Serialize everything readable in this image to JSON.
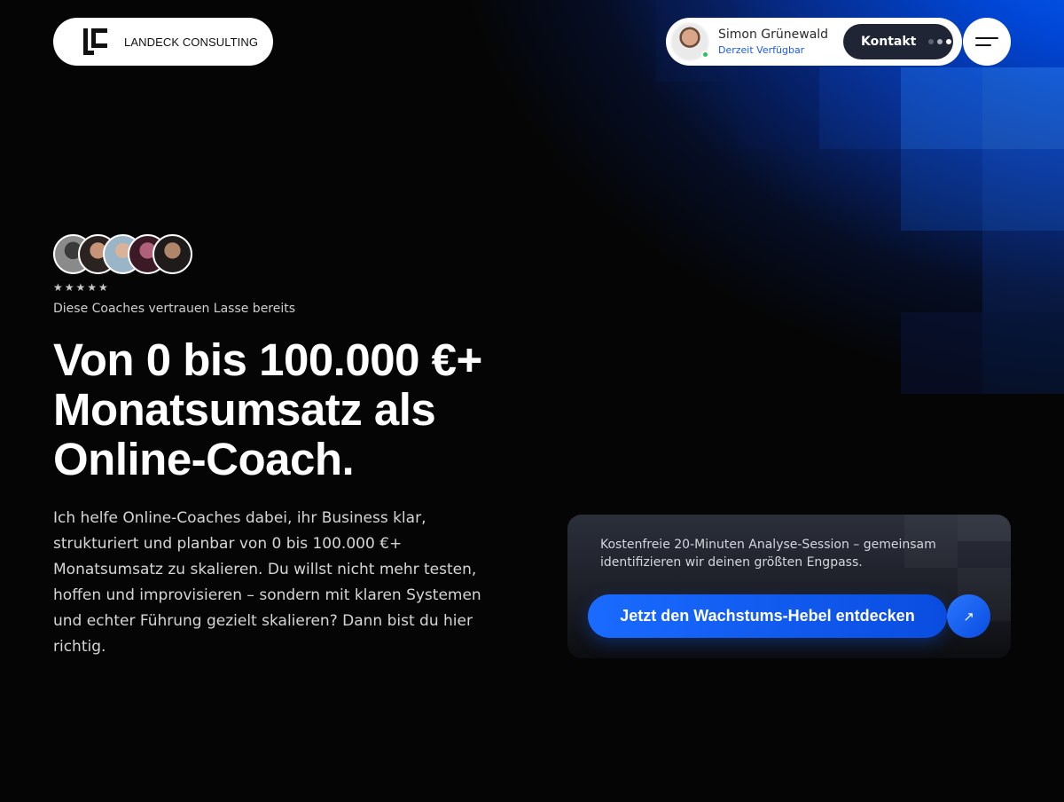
{
  "header": {
    "brand_name": "LANDECK CONSULTING",
    "contact": {
      "name": "Simon Grünewald",
      "status": "Derzeit Verfügbar",
      "button_label": "Kontakt"
    }
  },
  "hero": {
    "rating": "★★★★★",
    "trust_text": "Diese Coaches vertrauen Lasse bereits",
    "headline": "Von 0 bis 100.000 €+ Monatsumsatz als Online-Coach.",
    "intro": "Ich helfe Online-Coaches dabei, ihr Business klar, strukturiert und planbar von 0 bis 100.000 €+ Monatsumsatz zu skalieren. Du willst nicht mehr testen, hoffen und improvisieren – sondern mit klaren Systemen und echter Führung gezielt skalieren? Dann bist du hier richtig."
  },
  "cta": {
    "description": "Kostenfreie 20-Minuten Analyse-Session – gemeinsam identifizieren wir deinen größten Engpass.",
    "button_label": "Jetzt den Wachstums-Hebel entdecken",
    "arrow_icon": "↗"
  },
  "colors": {
    "accent": "#0a5cff",
    "background": "#050505",
    "online": "#22c55e"
  }
}
